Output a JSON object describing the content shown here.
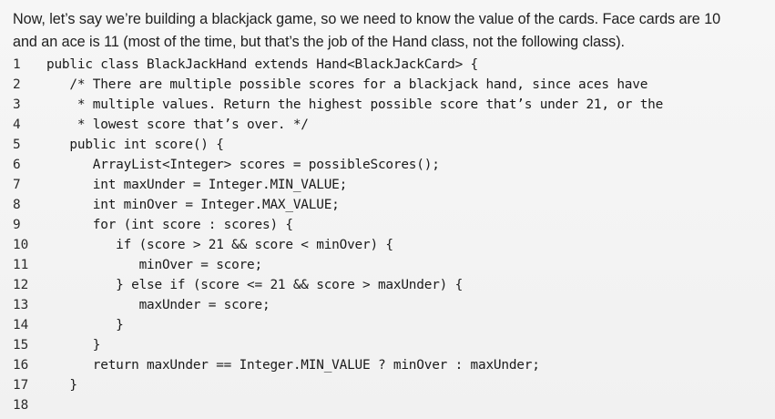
{
  "intro": {
    "line1": "Now, let’s say we’re building a blackjack game, so we need to know the value of the cards. Face cards are 10",
    "line2": "and an ace is 11 (most of the time, but that’s the job of the Hand class, not the following class)."
  },
  "code": {
    "lines": [
      {
        "num": "1",
        "text": "public class BlackJackHand extends Hand<BlackJackCard> {"
      },
      {
        "num": "2",
        "text": "   /* There are multiple possible scores for a blackjack hand, since aces have"
      },
      {
        "num": "3",
        "text": "    * multiple values. Return the highest possible score that’s under 21, or the"
      },
      {
        "num": "4",
        "text": "    * lowest score that’s over. */"
      },
      {
        "num": "5",
        "text": "   public int score() {"
      },
      {
        "num": "6",
        "text": "      ArrayList<Integer> scores = possibleScores();"
      },
      {
        "num": "7",
        "text": "      int maxUnder = Integer.MIN_VALUE;"
      },
      {
        "num": "8",
        "text": "      int minOver = Integer.MAX_VALUE;"
      },
      {
        "num": "9",
        "text": "      for (int score : scores) {"
      },
      {
        "num": "10",
        "text": "         if (score > 21 && score < minOver) {"
      },
      {
        "num": "11",
        "text": "            minOver = score;"
      },
      {
        "num": "12",
        "text": "         } else if (score <= 21 && score > maxUnder) {"
      },
      {
        "num": "13",
        "text": "            maxUnder = score;"
      },
      {
        "num": "14",
        "text": "         }"
      },
      {
        "num": "15",
        "text": "      }"
      },
      {
        "num": "16",
        "text": "      return maxUnder == Integer.MIN_VALUE ? minOver : maxUnder;"
      },
      {
        "num": "17",
        "text": "   }"
      },
      {
        "num": "18",
        "text": ""
      }
    ]
  }
}
